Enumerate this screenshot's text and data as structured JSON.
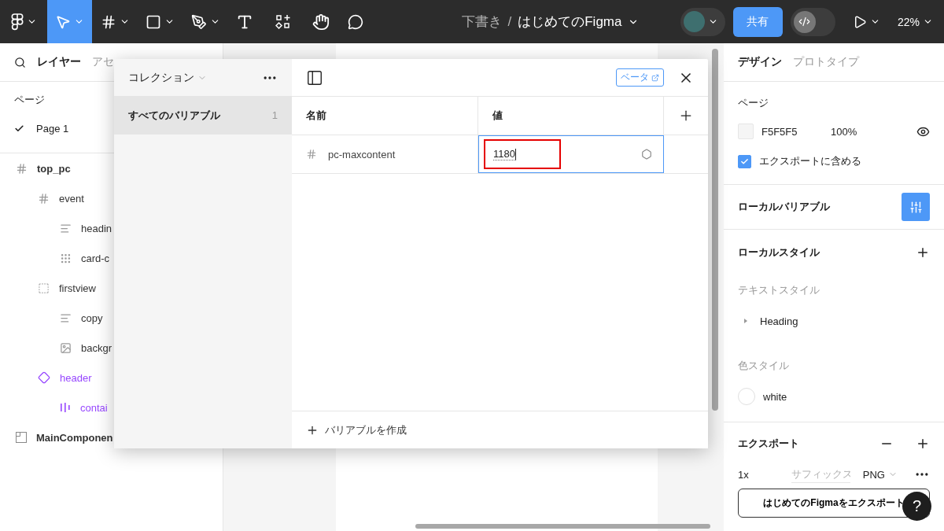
{
  "toolbar": {
    "tools": [
      {
        "kind": "logo",
        "selected": false,
        "menu": true
      },
      {
        "kind": "move",
        "selected": true,
        "menu": true
      },
      {
        "kind": "frame",
        "selected": false,
        "menu": true
      },
      {
        "kind": "shape",
        "selected": false,
        "menu": true
      },
      {
        "kind": "pen",
        "selected": false,
        "menu": true
      },
      {
        "kind": "text",
        "selected": false,
        "menu": false
      },
      {
        "kind": "resources",
        "selected": false,
        "menu": false
      },
      {
        "kind": "hand",
        "selected": false,
        "menu": false
      },
      {
        "kind": "comment",
        "selected": false,
        "menu": false
      }
    ],
    "dev_mode": {
      "on": false
    },
    "location": "下書き",
    "separator": "/",
    "file_name": "はじめてのFigma",
    "share_button": "共有",
    "zoom": "22%"
  },
  "layers_panel": {
    "tabs": [
      {
        "label": "レイヤー",
        "selected": true
      },
      {
        "label": "アセ",
        "selected": false
      }
    ],
    "pages_title": "ページ",
    "pages": [
      {
        "name": "Page 1",
        "selected": true
      }
    ],
    "layers": [
      {
        "name": "top_pc",
        "kind": "frame",
        "children": [
          {
            "name": "event",
            "kind": "frame",
            "children": [
              {
                "name": "headin",
                "kind": "text"
              },
              {
                "name": "card-c",
                "kind": "grid"
              }
            ]
          },
          {
            "name": "firstview",
            "kind": "dashed-frame",
            "children": [
              {
                "name": "copy",
                "kind": "text"
              },
              {
                "name": "backgr",
                "kind": "image"
              }
            ]
          },
          {
            "name": "header",
            "kind": "component",
            "children": [
              {
                "name": "contai",
                "kind": "instance"
              }
            ]
          }
        ]
      },
      {
        "name": "MainComponen",
        "kind": "section"
      }
    ]
  },
  "variables_dialog": {
    "collection_menu": "コレクション",
    "collections": [
      {
        "name": "すべてのバリアブル",
        "count": "1",
        "selected": true
      }
    ],
    "badge": "ベータ",
    "columns": [
      "名前",
      "値"
    ],
    "variables": [
      {
        "name": "pc-maxcontent",
        "value": "1180",
        "editing": true,
        "highlighted": true
      }
    ],
    "create_button": "バリアブルを作成"
  },
  "design_panel": {
    "tabs": [
      {
        "label": "デザイン",
        "selected": true
      },
      {
        "label": "プロトタイプ",
        "selected": false
      }
    ],
    "page": {
      "title": "ページ",
      "color": "F5F5F5",
      "opacity": "100%",
      "export_checkbox": {
        "label": "エクスポートに含める",
        "checked": true
      }
    },
    "local_variables": "ローカルバリアブル",
    "local_styles": {
      "title": "ローカルスタイル",
      "text_styles_title": "テキストスタイル",
      "text_styles": [
        {
          "name": "Heading",
          "expanded": false
        }
      ],
      "color_styles_title": "色スタイル",
      "color_styles": [
        {
          "name": "white",
          "color": "#ffffff"
        }
      ]
    },
    "export": {
      "title": "エクスポート",
      "scale": "1x",
      "suffix_placeholder": "サフィックス",
      "format": "PNG",
      "button": "はじめてのFigmaをエクスポート"
    }
  },
  "help_button": "?"
}
